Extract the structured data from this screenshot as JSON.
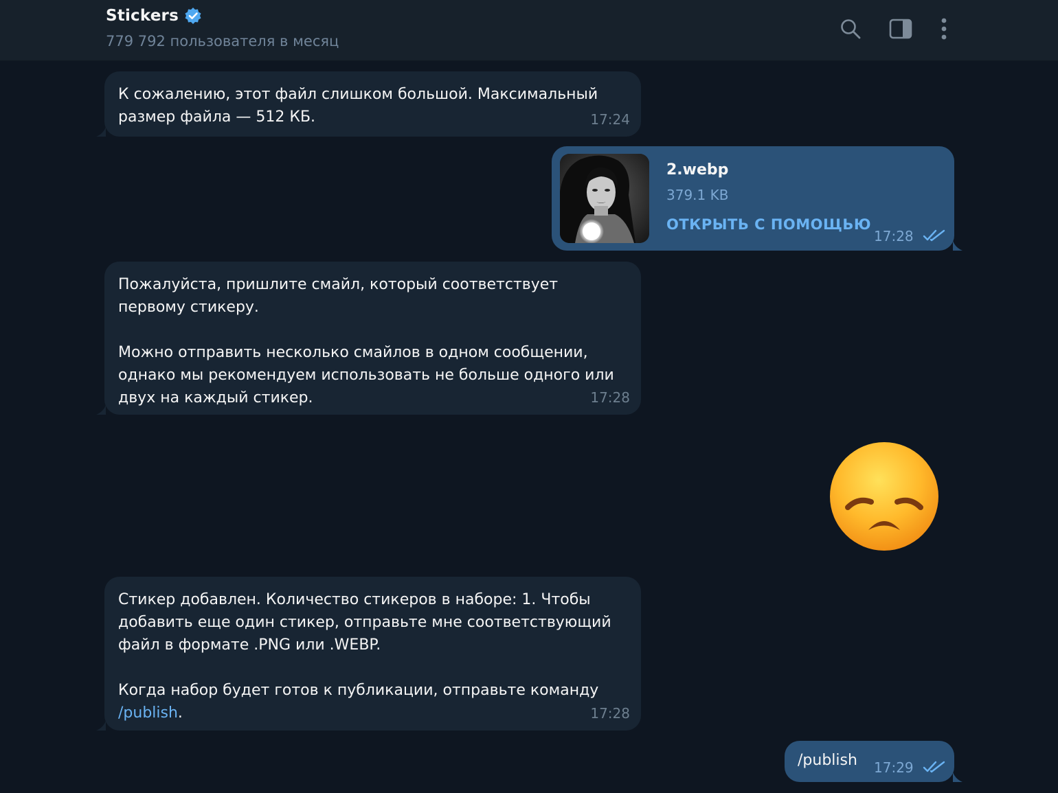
{
  "header": {
    "title": "Stickers",
    "subtitle": "779 792 пользователя в месяц"
  },
  "icons": {
    "verified": "verified-badge-icon",
    "search": "search-icon",
    "sidebar": "sidebar-toggle-icon",
    "menu": "more-vertical-icon",
    "read": "double-check-icon"
  },
  "messages": {
    "m1": {
      "text": "К сожалению, этот файл слишком большой. Максимальный размер файла — 512 КБ.",
      "time": "17:24"
    },
    "m2": {
      "file_name": "2.webp",
      "file_size": "379.1 KB",
      "open_label": "ОТКРЫТЬ С ПОМОЩЬЮ",
      "time": "17:28"
    },
    "m3": {
      "p1": "Пожалуйста, пришлите смайл, который соответствует первому стикеру.",
      "p2": "Можно отправить несколько смайлов в одном сообщении, однако мы рекомендуем использовать не больше одного или двух на каждый стикер.",
      "time": "17:28"
    },
    "m4": {
      "emoji": "😞"
    },
    "m5": {
      "p1": "Стикер добавлен. Количество стикеров в наборе: 1. Чтобы добавить еще один стикер, отправьте мне соответствующий файл в формате .PNG или .WEBP.",
      "p2": "Когда набор будет готов к публикации, отправьте команду",
      "command": "/publish",
      "p2_end": ".",
      "time": "17:28"
    },
    "m6": {
      "text": "/publish",
      "time": "17:29"
    }
  },
  "colors": {
    "background": "#0e1621",
    "header": "#17212b",
    "incoming_bubble": "#182533",
    "outgoing_bubble": "#2b5278",
    "accent": "#6ab3f3",
    "verified": "#4fa8f0"
  }
}
